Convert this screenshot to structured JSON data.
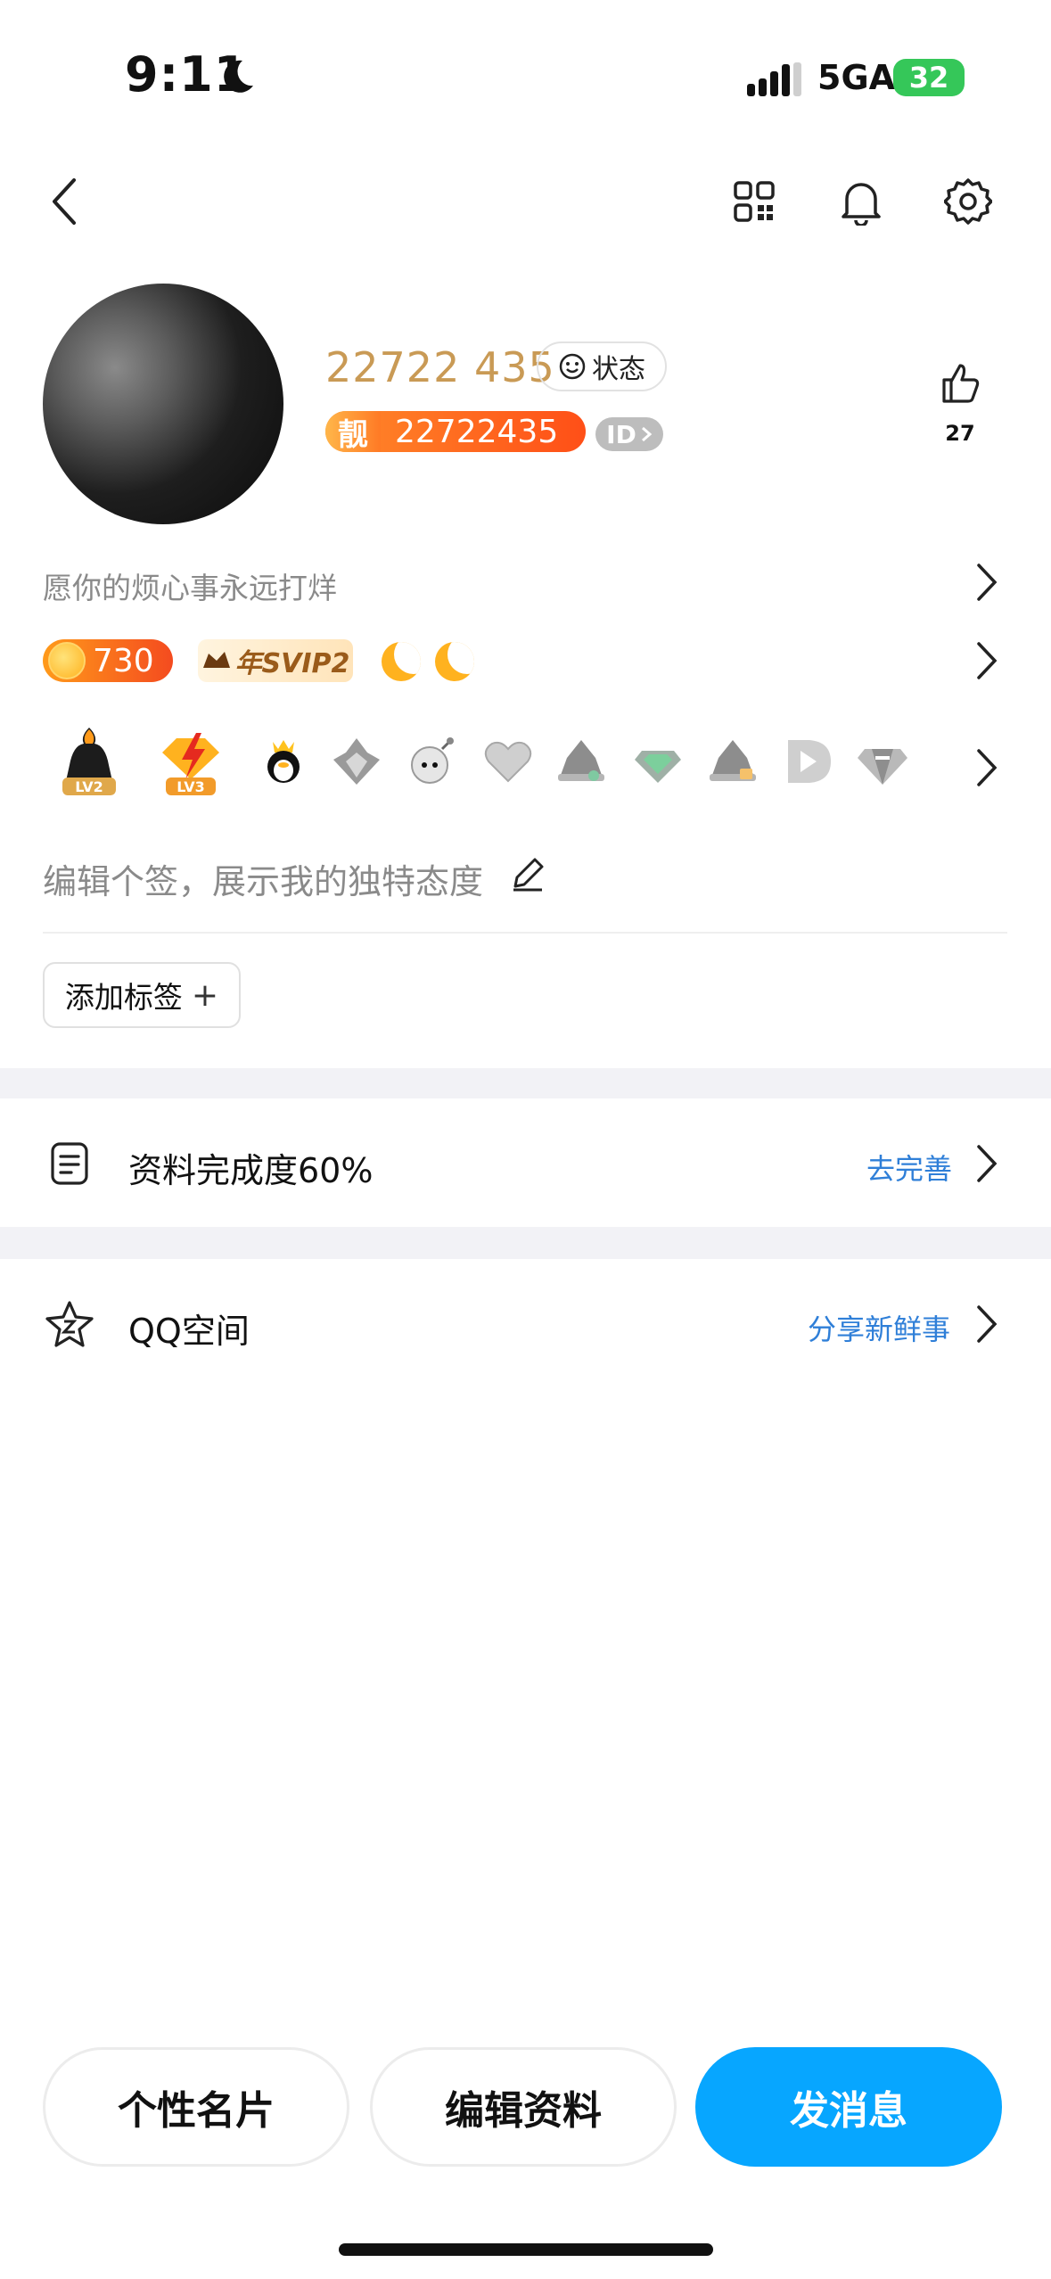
{
  "status_bar": {
    "time": "9:11",
    "network": "5GA",
    "battery": "32"
  },
  "profile": {
    "nickname": "22722 435",
    "status_label": "状态",
    "pretty_tag": "靓",
    "pretty_number": "22722435",
    "id_badge": "ID",
    "likes": "27",
    "signature": "愿你的烦心事永远打烊",
    "level_coin": "730",
    "svip_label": "年SVIP2",
    "medals": [
      "LV2",
      "LV3"
    ],
    "edit_signature_placeholder": "编辑个签，展示我的独特态度",
    "add_tag_label": "添加标签",
    "add_tag_plus": "+"
  },
  "rows": {
    "completeness_label": "资料完成度60%",
    "completeness_action": "去完善",
    "qzone_label": "QQ空间",
    "qzone_action": "分享新鲜事"
  },
  "bottom_buttons": {
    "card": "个性名片",
    "edit": "编辑资料",
    "message": "发消息"
  },
  "colors": {
    "accent_blue": "#07a6ff",
    "link_blue": "#2f7fd8",
    "nickname_gold": "#c99a55",
    "badge_orange": "#ff5a1f"
  }
}
